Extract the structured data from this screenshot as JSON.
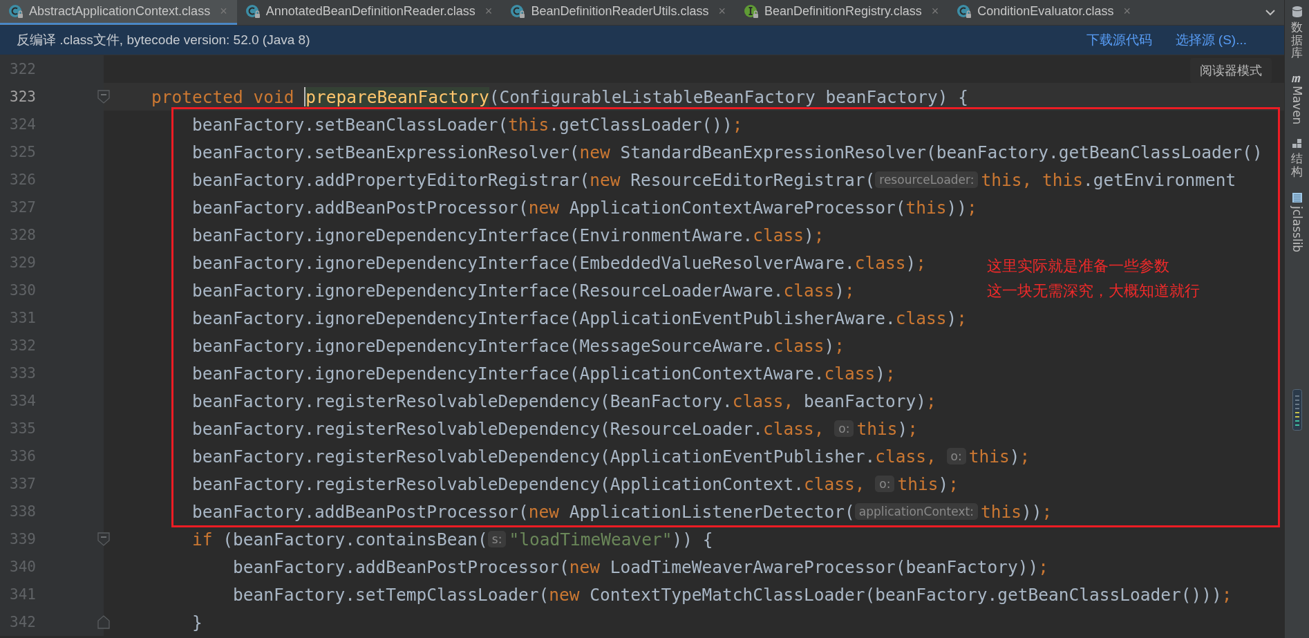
{
  "tabs": [
    {
      "label": "AbstractApplicationContext.class",
      "kind": "class",
      "close": "×",
      "selected": true
    },
    {
      "label": "AnnotatedBeanDefinitionReader.class",
      "kind": "class",
      "close": "×",
      "selected": false
    },
    {
      "label": "BeanDefinitionReaderUtils.class",
      "kind": "class",
      "close": "×",
      "selected": false
    },
    {
      "label": "BeanDefinitionRegistry.class",
      "kind": "interface",
      "close": "×",
      "selected": false
    },
    {
      "label": "ConditionEvaluator.class",
      "kind": "class",
      "close": "×",
      "selected": false
    }
  ],
  "banner": {
    "message": "反编译 .class文件, bytecode version: 52.0 (Java 8)",
    "links": [
      "下载源代码",
      "选择源 (S)..."
    ]
  },
  "editor": {
    "reader_mode": "阅读器模式",
    "lines": [
      {
        "number": "322",
        "current": false
      },
      {
        "number": "323",
        "current": true,
        "kind": "fold-start",
        "tokens": [
          {
            "kind": "keyword",
            "text": "    protected void "
          },
          {
            "kind": "declaration",
            "text": "prepareBeanFactory"
          },
          {
            "kind": "plain",
            "text": "(ConfigurableListableBeanFactory beanFactory) {"
          }
        ]
      },
      {
        "number": "324",
        "current": false,
        "tokens": [
          {
            "kind": "plain",
            "text": "        beanFactory.setBeanClassLoader("
          },
          {
            "kind": "keyword",
            "text": "this"
          },
          {
            "kind": "plain",
            "text": ".getClassLoader())"
          },
          {
            "kind": "keyword",
            "text": ";"
          }
        ]
      },
      {
        "number": "325",
        "current": false,
        "tokens": [
          {
            "kind": "plain",
            "text": "        beanFactory.setBeanExpressionResolver("
          },
          {
            "kind": "keyword",
            "text": "new"
          },
          {
            "kind": "plain",
            "text": " StandardBeanExpressionResolver(beanFactory.getBeanClassLoader()"
          }
        ]
      },
      {
        "number": "326",
        "current": false,
        "tokens": [
          {
            "kind": "plain",
            "text": "        beanFactory.addPropertyEditorRegistrar("
          },
          {
            "kind": "keyword",
            "text": "new"
          },
          {
            "kind": "plain",
            "text": " ResourceEditorRegistrar("
          },
          {
            "kind": "hint",
            "text": "resourceLoader:"
          },
          {
            "kind": "keyword",
            "text": "this, this"
          },
          {
            "kind": "plain",
            "text": ".getEnvironment"
          }
        ]
      },
      {
        "number": "327",
        "current": false,
        "tokens": [
          {
            "kind": "plain",
            "text": "        beanFactory.addBeanPostProcessor("
          },
          {
            "kind": "keyword",
            "text": "new"
          },
          {
            "kind": "plain",
            "text": " ApplicationContextAwareProcessor("
          },
          {
            "kind": "keyword",
            "text": "this"
          },
          {
            "kind": "plain",
            "text": "))"
          },
          {
            "kind": "keyword",
            "text": ";"
          }
        ]
      },
      {
        "number": "328",
        "current": false,
        "tokens": [
          {
            "kind": "plain",
            "text": "        beanFactory.ignoreDependencyInterface(EnvironmentAware."
          },
          {
            "kind": "keyword",
            "text": "class"
          },
          {
            "kind": "plain",
            "text": ")"
          },
          {
            "kind": "keyword",
            "text": ";"
          }
        ]
      },
      {
        "number": "329",
        "current": false,
        "tokens": [
          {
            "kind": "plain",
            "text": "        beanFactory.ignoreDependencyInterface(EmbeddedValueResolverAware."
          },
          {
            "kind": "keyword",
            "text": "class"
          },
          {
            "kind": "plain",
            "text": ")"
          },
          {
            "kind": "keyword",
            "text": ";"
          }
        ]
      },
      {
        "number": "330",
        "current": false,
        "tokens": [
          {
            "kind": "plain",
            "text": "        beanFactory.ignoreDependencyInterface(ResourceLoaderAware."
          },
          {
            "kind": "keyword",
            "text": "class"
          },
          {
            "kind": "plain",
            "text": ")"
          },
          {
            "kind": "keyword",
            "text": ";"
          }
        ]
      },
      {
        "number": "331",
        "current": false,
        "tokens": [
          {
            "kind": "plain",
            "text": "        beanFactory.ignoreDependencyInterface(ApplicationEventPublisherAware."
          },
          {
            "kind": "keyword",
            "text": "class"
          },
          {
            "kind": "plain",
            "text": ")"
          },
          {
            "kind": "keyword",
            "text": ";"
          }
        ]
      },
      {
        "number": "332",
        "current": false,
        "tokens": [
          {
            "kind": "plain",
            "text": "        beanFactory.ignoreDependencyInterface(MessageSourceAware."
          },
          {
            "kind": "keyword",
            "text": "class"
          },
          {
            "kind": "plain",
            "text": ")"
          },
          {
            "kind": "keyword",
            "text": ";"
          }
        ]
      },
      {
        "number": "333",
        "current": false,
        "tokens": [
          {
            "kind": "plain",
            "text": "        beanFactory.ignoreDependencyInterface(ApplicationContextAware."
          },
          {
            "kind": "keyword",
            "text": "class"
          },
          {
            "kind": "plain",
            "text": ")"
          },
          {
            "kind": "keyword",
            "text": ";"
          }
        ]
      },
      {
        "number": "334",
        "current": false,
        "tokens": [
          {
            "kind": "plain",
            "text": "        beanFactory.registerResolvableDependency(BeanFactory."
          },
          {
            "kind": "keyword",
            "text": "class,"
          },
          {
            "kind": "plain",
            "text": " beanFactory)"
          },
          {
            "kind": "keyword",
            "text": ";"
          }
        ]
      },
      {
        "number": "335",
        "current": false,
        "tokens": [
          {
            "kind": "plain",
            "text": "        beanFactory.registerResolvableDependency(ResourceLoader."
          },
          {
            "kind": "keyword",
            "text": "class, "
          },
          {
            "kind": "hint",
            "text": "o:"
          },
          {
            "kind": "keyword",
            "text": "this"
          },
          {
            "kind": "plain",
            "text": ")"
          },
          {
            "kind": "keyword",
            "text": ";"
          }
        ]
      },
      {
        "number": "336",
        "current": false,
        "tokens": [
          {
            "kind": "plain",
            "text": "        beanFactory.registerResolvableDependency(ApplicationEventPublisher."
          },
          {
            "kind": "keyword",
            "text": "class, "
          },
          {
            "kind": "hint",
            "text": "o:"
          },
          {
            "kind": "keyword",
            "text": "this"
          },
          {
            "kind": "plain",
            "text": ")"
          },
          {
            "kind": "keyword",
            "text": ";"
          }
        ]
      },
      {
        "number": "337",
        "current": false,
        "tokens": [
          {
            "kind": "plain",
            "text": "        beanFactory.registerResolvableDependency(ApplicationContext."
          },
          {
            "kind": "keyword",
            "text": "class, "
          },
          {
            "kind": "hint",
            "text": "o:"
          },
          {
            "kind": "keyword",
            "text": "this"
          },
          {
            "kind": "plain",
            "text": ")"
          },
          {
            "kind": "keyword",
            "text": ";"
          }
        ]
      },
      {
        "number": "338",
        "current": false,
        "tokens": [
          {
            "kind": "plain",
            "text": "        beanFactory.addBeanPostProcessor("
          },
          {
            "kind": "keyword",
            "text": "new"
          },
          {
            "kind": "plain",
            "text": " ApplicationListenerDetector("
          },
          {
            "kind": "hint",
            "text": "applicationContext:"
          },
          {
            "kind": "keyword",
            "text": "this"
          },
          {
            "kind": "plain",
            "text": "))"
          },
          {
            "kind": "keyword",
            "text": ";"
          }
        ]
      },
      {
        "number": "339",
        "current": false,
        "kind": "fold-start",
        "tokens": [
          {
            "kind": "keyword",
            "text": "        if"
          },
          {
            "kind": "plain",
            "text": " (beanFactory.containsBean("
          },
          {
            "kind": "hint",
            "text": "s:"
          },
          {
            "kind": "string",
            "text": "\"loadTimeWeaver\""
          },
          {
            "kind": "plain",
            "text": ")) {"
          }
        ]
      },
      {
        "number": "340",
        "current": false,
        "tokens": [
          {
            "kind": "plain",
            "text": "            beanFactory.addBeanPostProcessor("
          },
          {
            "kind": "keyword",
            "text": "new"
          },
          {
            "kind": "plain",
            "text": " LoadTimeWeaverAwareProcessor(beanFactory))"
          },
          {
            "kind": "keyword",
            "text": ";"
          }
        ]
      },
      {
        "number": "341",
        "current": false,
        "tokens": [
          {
            "kind": "plain",
            "text": "            beanFactory.setTempClassLoader("
          },
          {
            "kind": "keyword",
            "text": "new"
          },
          {
            "kind": "plain",
            "text": " ContextTypeMatchClassLoader(beanFactory.getBeanClassLoader()))"
          },
          {
            "kind": "keyword",
            "text": ";"
          }
        ]
      },
      {
        "number": "342",
        "current": false,
        "kind": "fold-end",
        "tokens": [
          {
            "kind": "plain",
            "text": "        }"
          }
        ]
      }
    ],
    "annotation": {
      "lines": [
        "这里实际就是准备一些参数",
        "这一块无需深究，大概知道就行"
      ]
    }
  },
  "sidebar": {
    "tools": [
      {
        "label": "数据库",
        "kind": "cjk"
      },
      {
        "label": "Maven",
        "kind": "latin"
      },
      {
        "label": "结构",
        "kind": "cjk"
      },
      {
        "label": "jclasslib",
        "kind": "latin"
      }
    ]
  }
}
